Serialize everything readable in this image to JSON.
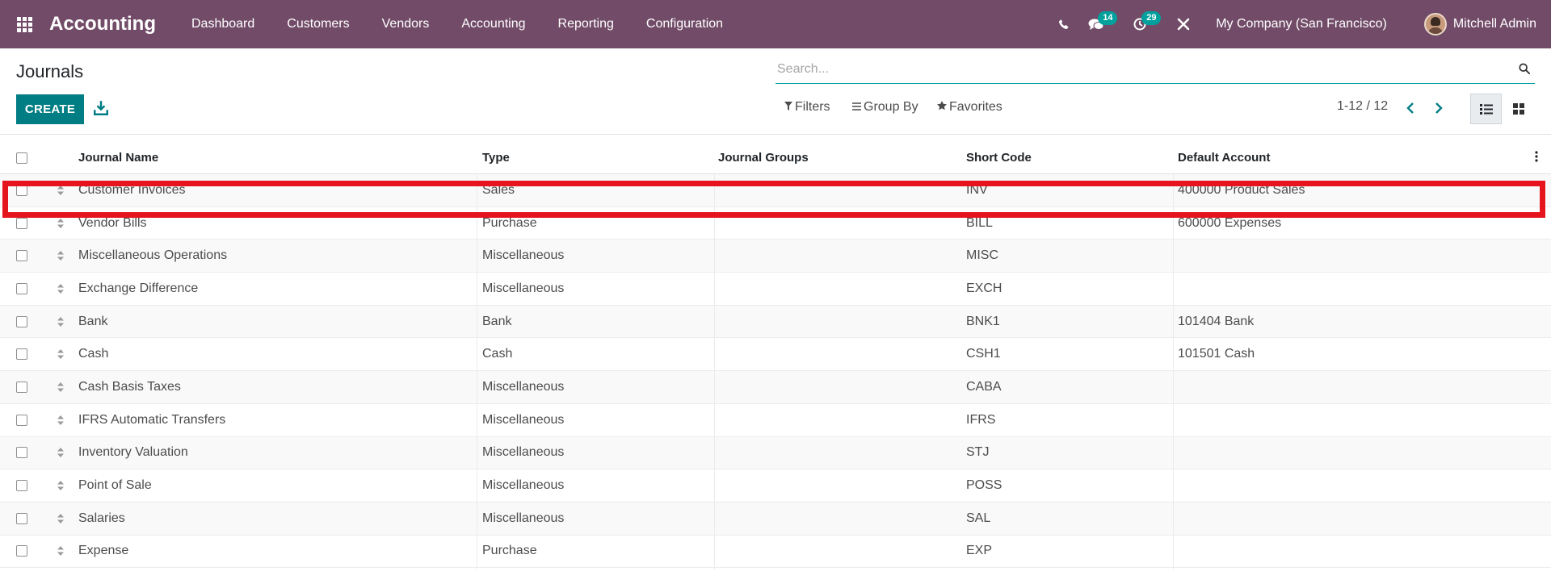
{
  "nav": {
    "brand": "Accounting",
    "menu": [
      "Dashboard",
      "Customers",
      "Vendors",
      "Accounting",
      "Reporting",
      "Configuration"
    ],
    "messages_badge": "14",
    "activities_badge": "29",
    "company": "My Company (San Francisco)",
    "user": "Mitchell Admin"
  },
  "control_panel": {
    "title": "Journals",
    "create_label": "CREATE",
    "search_placeholder": "Search...",
    "filters_label": "Filters",
    "groupby_label": "Group By",
    "favorites_label": "Favorites",
    "pager": "1-12 / 12"
  },
  "table": {
    "headers": [
      "Journal Name",
      "Type",
      "Journal Groups",
      "Short Code",
      "Default Account"
    ],
    "rows": [
      {
        "name": "Customer Invoices",
        "type": "Sales",
        "groups": "",
        "code": "INV",
        "account": "400000 Product Sales"
      },
      {
        "name": "Vendor Bills",
        "type": "Purchase",
        "groups": "",
        "code": "BILL",
        "account": "600000 Expenses"
      },
      {
        "name": "Miscellaneous Operations",
        "type": "Miscellaneous",
        "groups": "",
        "code": "MISC",
        "account": ""
      },
      {
        "name": "Exchange Difference",
        "type": "Miscellaneous",
        "groups": "",
        "code": "EXCH",
        "account": ""
      },
      {
        "name": "Bank",
        "type": "Bank",
        "groups": "",
        "code": "BNK1",
        "account": "101404 Bank"
      },
      {
        "name": "Cash",
        "type": "Cash",
        "groups": "",
        "code": "CSH1",
        "account": "101501 Cash"
      },
      {
        "name": "Cash Basis Taxes",
        "type": "Miscellaneous",
        "groups": "",
        "code": "CABA",
        "account": ""
      },
      {
        "name": "IFRS Automatic Transfers",
        "type": "Miscellaneous",
        "groups": "",
        "code": "IFRS",
        "account": ""
      },
      {
        "name": "Inventory Valuation",
        "type": "Miscellaneous",
        "groups": "",
        "code": "STJ",
        "account": ""
      },
      {
        "name": "Point of Sale",
        "type": "Miscellaneous",
        "groups": "",
        "code": "POSS",
        "account": ""
      },
      {
        "name": "Salaries",
        "type": "Miscellaneous",
        "groups": "",
        "code": "SAL",
        "account": ""
      },
      {
        "name": "Expense",
        "type": "Purchase",
        "groups": "",
        "code": "EXP",
        "account": ""
      }
    ]
  },
  "colors": {
    "navbar": "#714b67",
    "primary_button": "#017e84",
    "badge": "#00a09d",
    "highlight": "#e5141d"
  }
}
